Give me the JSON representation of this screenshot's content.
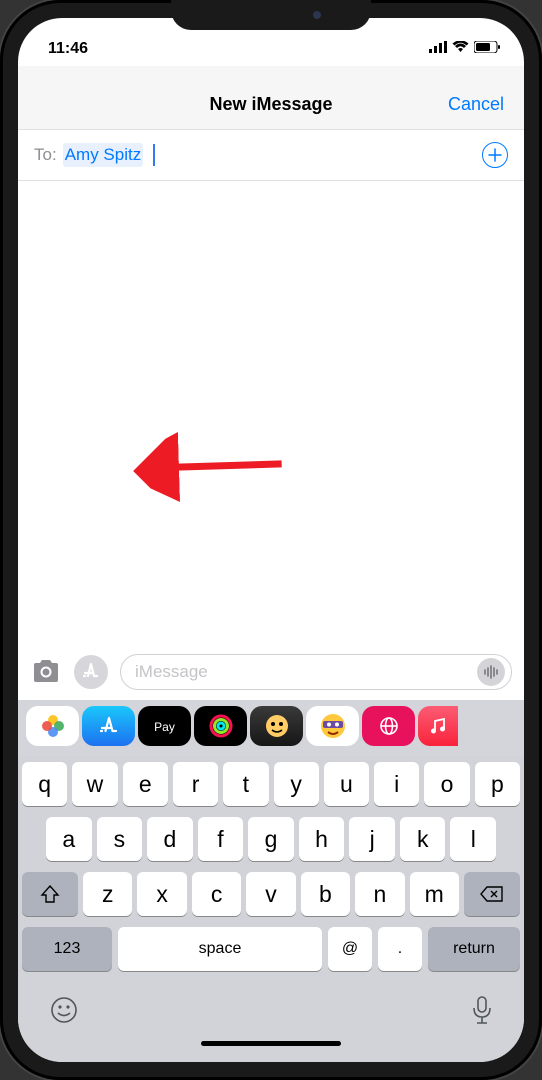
{
  "status": {
    "time": "11:46"
  },
  "header": {
    "title": "New iMessage",
    "cancel": "Cancel"
  },
  "to_row": {
    "label": "To:",
    "recipient": "Amy Spitz"
  },
  "input": {
    "placeholder": "iMessage"
  },
  "apps": [
    {
      "name": "photos-app"
    },
    {
      "name": "appstore-app"
    },
    {
      "name": "applepay-app",
      "label": "Pay"
    },
    {
      "name": "activity-app"
    },
    {
      "name": "memoji-app"
    },
    {
      "name": "animoji-app"
    },
    {
      "name": "search-app"
    },
    {
      "name": "music-app"
    }
  ],
  "keyboard": {
    "row1": [
      "q",
      "w",
      "e",
      "r",
      "t",
      "y",
      "u",
      "i",
      "o",
      "p"
    ],
    "row2": [
      "a",
      "s",
      "d",
      "f",
      "g",
      "h",
      "j",
      "k",
      "l"
    ],
    "row3": [
      "z",
      "x",
      "c",
      "v",
      "b",
      "n",
      "m"
    ],
    "numKey": "123",
    "space": "space",
    "at": "@",
    "dot": ".",
    "ret": "return"
  }
}
